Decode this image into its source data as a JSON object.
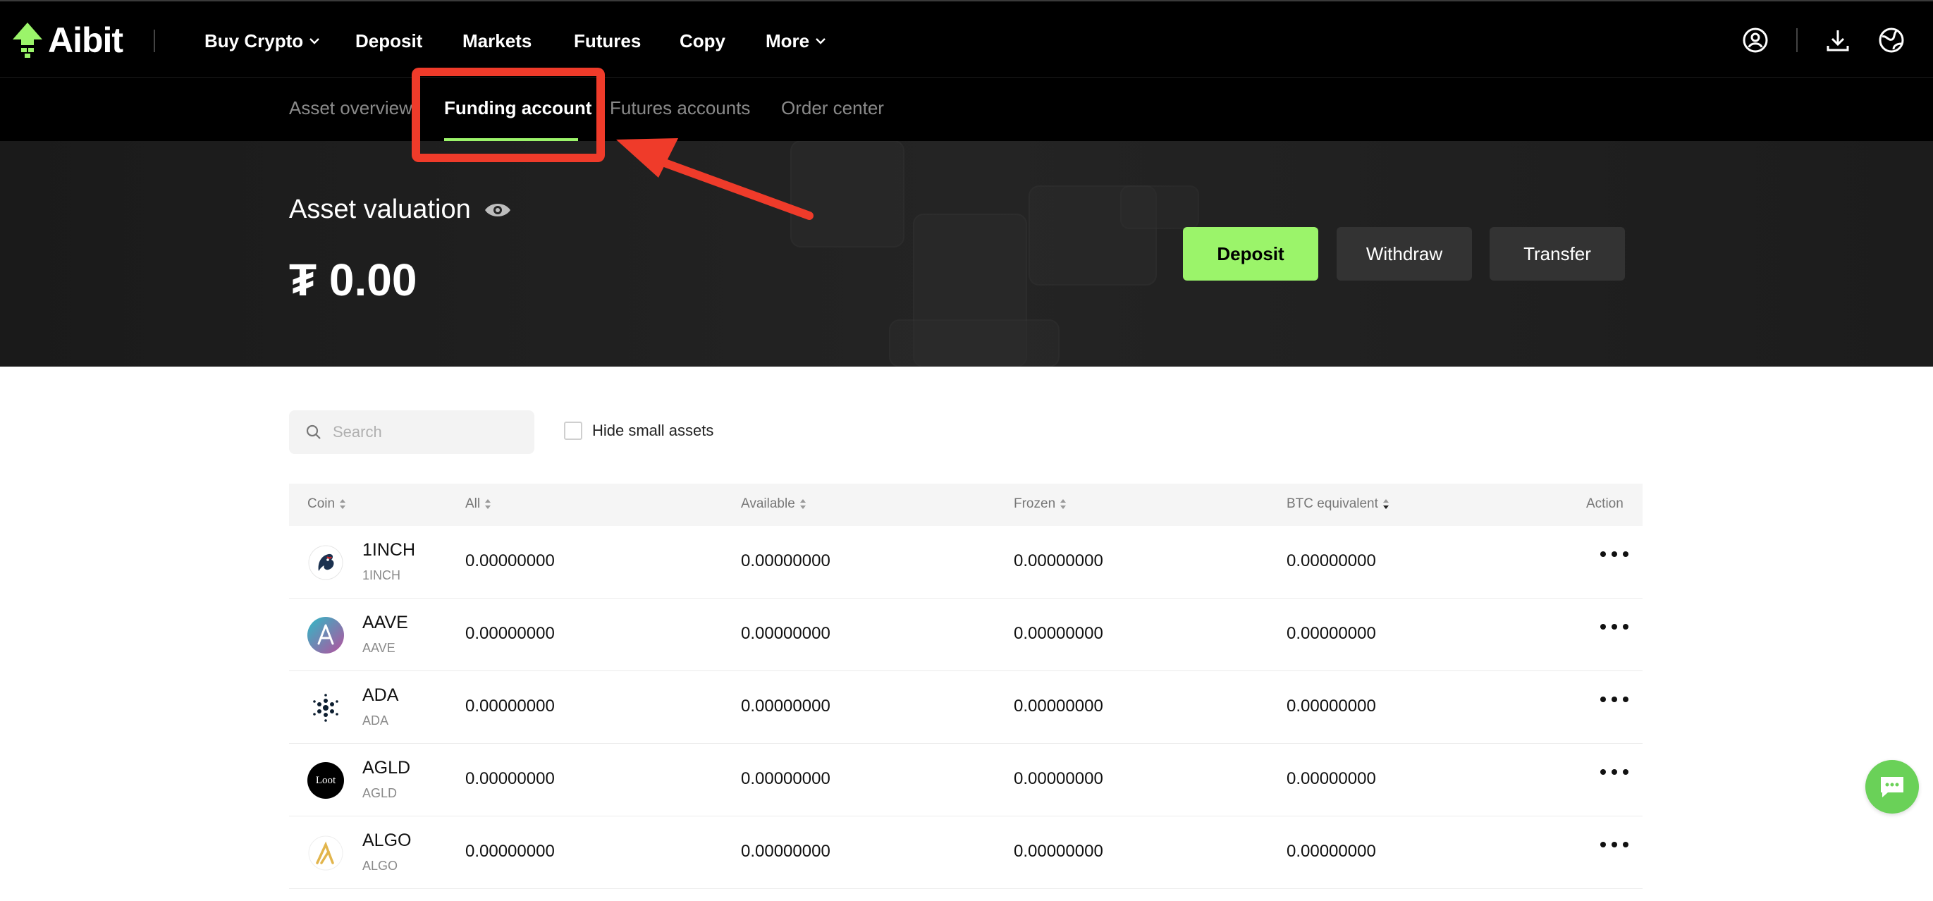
{
  "brand": {
    "name": "Aibit",
    "accent": "#9bf46a"
  },
  "topnav": {
    "items": [
      {
        "label": "Buy Crypto",
        "has_dropdown": true
      },
      {
        "label": "Deposit"
      },
      {
        "label": "Markets"
      },
      {
        "label": "Futures"
      },
      {
        "label": "Copy"
      },
      {
        "label": "More",
        "has_dropdown": true
      }
    ],
    "right_icons": [
      "user-icon",
      "download-icon",
      "globe-icon"
    ]
  },
  "subnav": {
    "tabs": [
      {
        "label": "Asset overview",
        "active": false
      },
      {
        "label": "Funding account",
        "active": true
      },
      {
        "label": "Futures accounts",
        "active": false
      },
      {
        "label": "Order center",
        "active": false
      }
    ]
  },
  "annotation": {
    "color": "#ef3b2a"
  },
  "banner": {
    "title": "Asset valuation",
    "amount": "₮ 0.00",
    "buttons": {
      "deposit": "Deposit",
      "withdraw": "Withdraw",
      "transfer": "Transfer"
    }
  },
  "filters": {
    "search_placeholder": "Search",
    "hide_small_label": "Hide small assets",
    "hide_small_checked": false
  },
  "table": {
    "headers": {
      "coin": "Coin",
      "all": "All",
      "available": "Available",
      "frozen": "Frozen",
      "btc": "BTC equivalent",
      "action": "Action"
    },
    "rows": [
      {
        "symbol": "1INCH",
        "name": "1INCH",
        "all": "0.00000000",
        "available": "0.00000000",
        "frozen": "0.00000000",
        "btc": "0.00000000"
      },
      {
        "symbol": "AAVE",
        "name": "AAVE",
        "all": "0.00000000",
        "available": "0.00000000",
        "frozen": "0.00000000",
        "btc": "0.00000000"
      },
      {
        "symbol": "ADA",
        "name": "ADA",
        "all": "0.00000000",
        "available": "0.00000000",
        "frozen": "0.00000000",
        "btc": "0.00000000"
      },
      {
        "symbol": "AGLD",
        "name": "AGLD",
        "all": "0.00000000",
        "available": "0.00000000",
        "frozen": "0.00000000",
        "btc": "0.00000000",
        "logo_text": "Loot"
      },
      {
        "symbol": "ALGO",
        "name": "ALGO",
        "all": "0.00000000",
        "available": "0.00000000",
        "frozen": "0.00000000",
        "btc": "0.00000000"
      }
    ]
  }
}
